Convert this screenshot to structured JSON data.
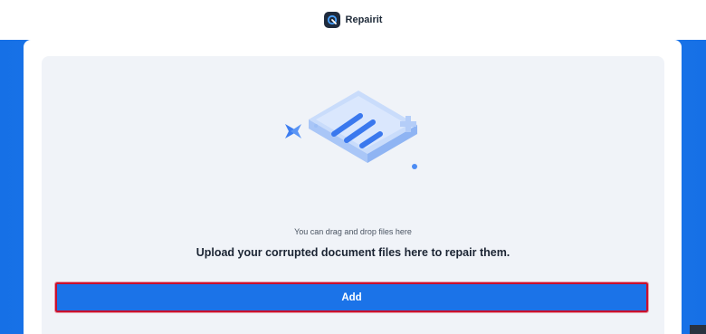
{
  "header": {
    "app_name": "Repairit"
  },
  "upload": {
    "hint": "You can drag and drop files here",
    "headline": "Upload your corrupted document files here to repair them.",
    "add_label": "Add"
  },
  "colors": {
    "accent": "#1b73e8",
    "highlight_border": "#c8102e",
    "background_band": "#1670e6"
  },
  "icons": {
    "logo": "repairit-logo-icon",
    "illustration": "document-upload-illustration"
  }
}
